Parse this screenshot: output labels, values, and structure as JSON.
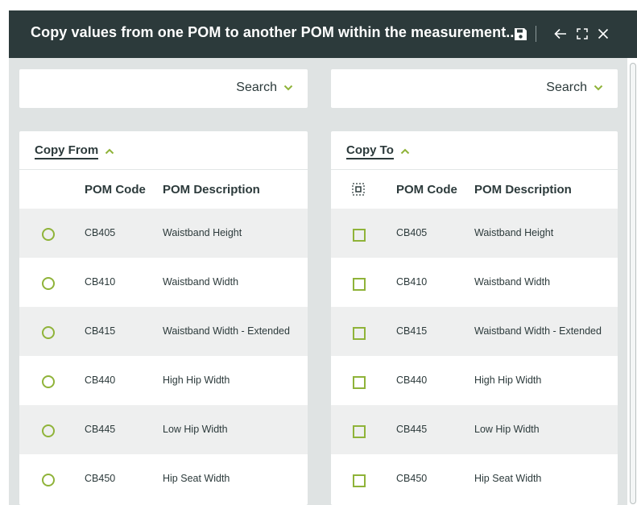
{
  "dialog": {
    "title": "Copy values from one POM to another POM within the measurement..."
  },
  "icons": {
    "save": "save-icon",
    "back": "arrow-left-icon",
    "expand": "expand-icon",
    "close": "close-icon",
    "chevron_down": "chevron-down-icon",
    "chevron_up": "chevron-up-icon"
  },
  "colors": {
    "header_bg": "#2c3a3b",
    "accent": "#8fb339",
    "row_alt": "#eeefef",
    "backdrop": "#dfe3e3"
  },
  "left_search": {
    "label": "Search"
  },
  "right_search": {
    "label": "Search"
  },
  "copy_from": {
    "title": "Copy From",
    "columns": {
      "code": "POM Code",
      "description": "POM Description"
    },
    "rows": [
      {
        "code": "CB405",
        "description": "Waistband Height"
      },
      {
        "code": "CB410",
        "description": "Waistband Width"
      },
      {
        "code": "CB415",
        "description": "Waistband Width - Extended"
      },
      {
        "code": "CB440",
        "description": "High Hip Width"
      },
      {
        "code": "CB445",
        "description": "Low Hip Width"
      },
      {
        "code": "CB450",
        "description": "Hip Seat Width"
      }
    ]
  },
  "copy_to": {
    "title": "Copy To",
    "columns": {
      "code": "POM Code",
      "description": "POM Description"
    },
    "rows": [
      {
        "code": "CB405",
        "description": "Waistband Height"
      },
      {
        "code": "CB410",
        "description": "Waistband Width"
      },
      {
        "code": "CB415",
        "description": "Waistband Width - Extended"
      },
      {
        "code": "CB440",
        "description": "High Hip Width"
      },
      {
        "code": "CB445",
        "description": "Low Hip Width"
      },
      {
        "code": "CB450",
        "description": "Hip Seat Width"
      }
    ]
  }
}
